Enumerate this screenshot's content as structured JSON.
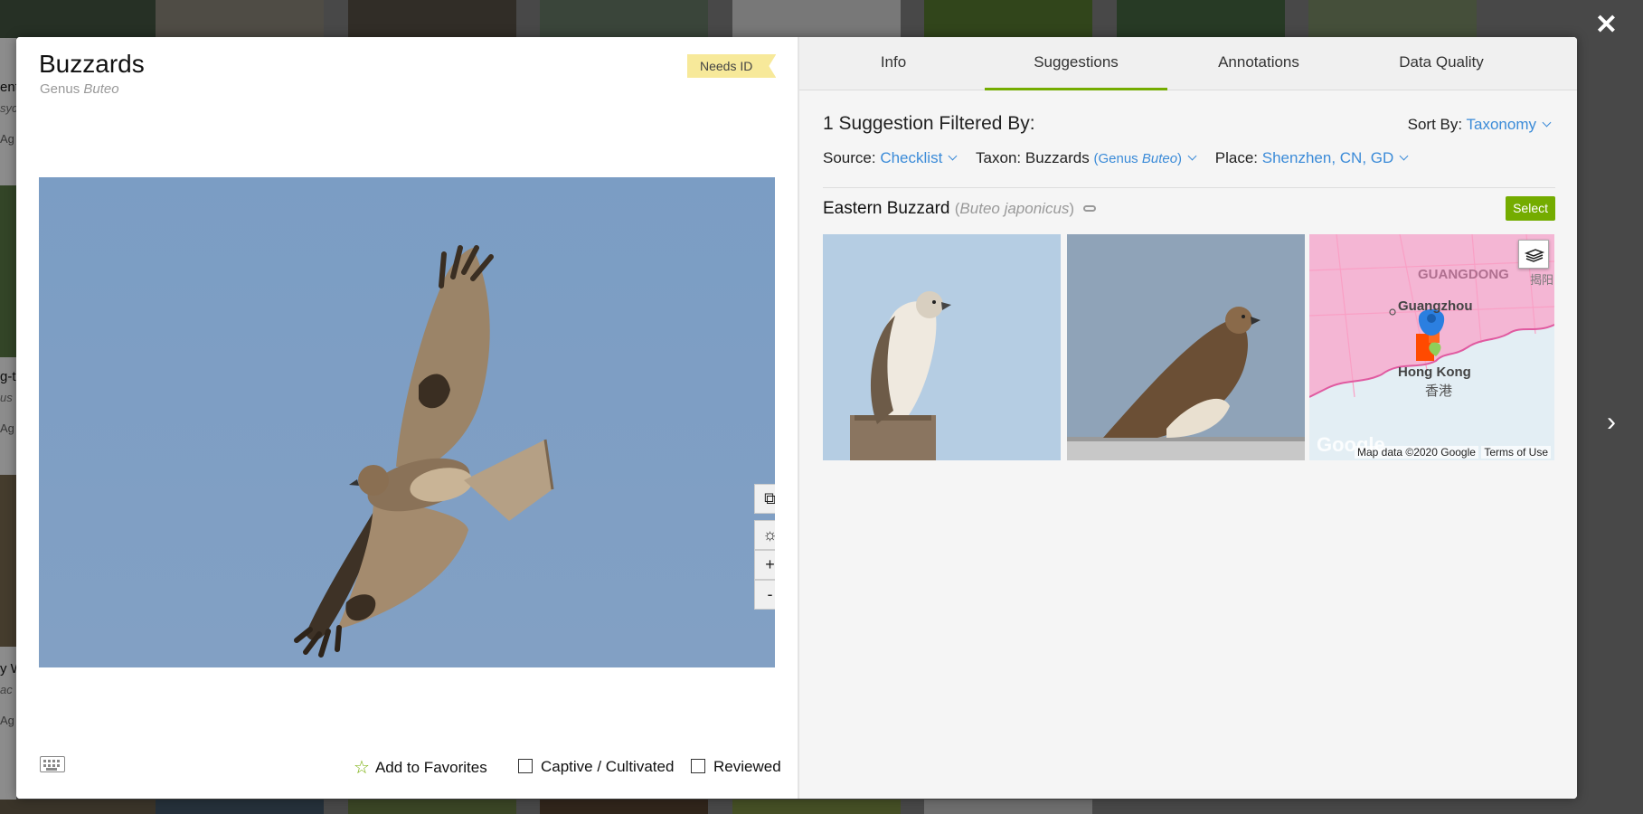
{
  "observation": {
    "title": "Buzzards",
    "rank": "Genus",
    "scientific_name": "Buteo",
    "quality_badge": "Needs ID"
  },
  "photo_controls": {
    "zoom_in": "+",
    "zoom_out": "-"
  },
  "footer": {
    "add_favorites": "Add to Favorites",
    "captive": "Captive / Cultivated",
    "reviewed": "Reviewed"
  },
  "tabs": [
    {
      "label": "Info"
    },
    {
      "label": "Suggestions",
      "active": true
    },
    {
      "label": "Annotations"
    },
    {
      "label": "Data Quality"
    }
  ],
  "suggestions": {
    "header": "1 Suggestion Filtered By:",
    "sort_label": "Sort By:",
    "sort_value": "Taxonomy",
    "source_label": "Source:",
    "source_value": "Checklist",
    "taxon_label": "Taxon:",
    "taxon_value": "Buzzards",
    "taxon_rank": "Genus",
    "taxon_sci": "Buteo",
    "place_label": "Place:",
    "place_value": "Shenzhen, CN, GD",
    "item": {
      "common_name": "Eastern Buzzard",
      "scientific_name": "Buteo japonicus",
      "select_label": "Select"
    },
    "map": {
      "label_province": "GUANGDONG",
      "label_city": "Guangzhou",
      "label_hk": "Hong Kong",
      "label_hk_cn": "香港",
      "label_edge": "揭阳",
      "google": "Google",
      "attribution": "Map data ©2020 Google",
      "terms": "Terms of Use"
    }
  },
  "background_text": {
    "left_items": [
      "ent",
      "syc",
      "Ag",
      "g-t",
      "us",
      "Ag",
      "y W",
      "ac",
      "Ag"
    ]
  },
  "colors": {
    "accent_green": "#74ac00",
    "link_blue": "#3b8bd8",
    "needs_id_yellow": "#f7e99a",
    "sky": "#7e9ec3"
  },
  "icons": {
    "close": "close-icon",
    "next": "chevron-right-icon",
    "star": "star-icon",
    "keyboard": "keyboard-icon",
    "external": "external-link-icon",
    "brightness": "brightness-icon",
    "link": "link-icon",
    "layers": "layers-icon"
  }
}
